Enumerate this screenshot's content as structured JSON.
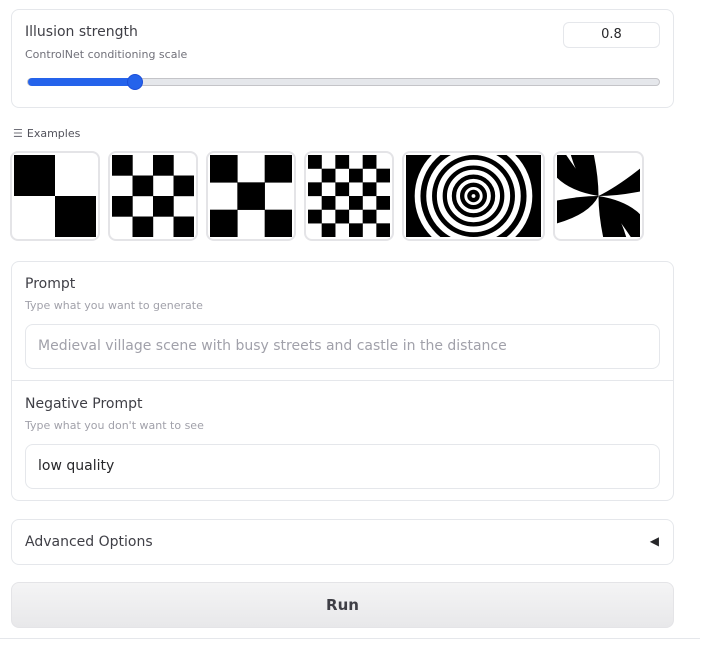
{
  "slider": {
    "title": "Illusion strength",
    "subtitle": "ControlNet conditioning scale",
    "value": "0.8",
    "fraction": 0.17,
    "accent_color": "#2563eb"
  },
  "examples": {
    "label": "Examples",
    "icon": "list-icon",
    "items": [
      {
        "kind": "checker-2"
      },
      {
        "kind": "checker-4"
      },
      {
        "kind": "checker-3"
      },
      {
        "kind": "checker-6"
      },
      {
        "kind": "spiral"
      },
      {
        "kind": "swirl"
      }
    ]
  },
  "prompt": {
    "title": "Prompt",
    "subtitle": "Type what you want to generate",
    "placeholder": "Medieval village scene with busy streets and castle in the distance",
    "value": ""
  },
  "negative_prompt": {
    "title": "Negative Prompt",
    "subtitle": "Type what you don't want to see",
    "value": "low quality"
  },
  "advanced": {
    "label": "Advanced Options",
    "icon": "triangle-left-icon"
  },
  "run": {
    "label": "Run"
  }
}
